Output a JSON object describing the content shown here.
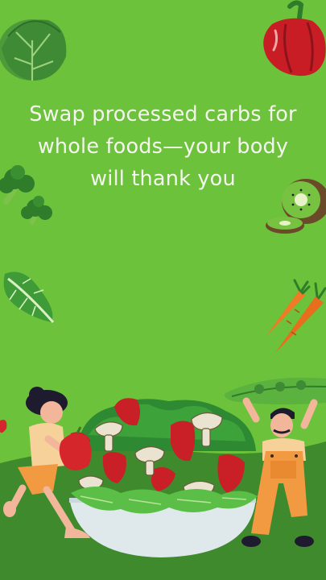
{
  "poster": {
    "headline_lines": [
      "Swap processed carbs for",
      "whole foods—your body",
      "will thank you"
    ]
  },
  "colors": {
    "background": "#6cc23a",
    "ground": "#3f8a2c",
    "text": "#f4f6ee",
    "bowl": "#dfe9ec",
    "pepper": "#c81d25",
    "carrot": "#ef7b26",
    "kiwi": "#78c242",
    "overalls": "#f19a42"
  },
  "illustrations": [
    "cabbage-icon",
    "bell-pepper-icon",
    "broccoli-icon",
    "kiwi-icon",
    "lettuce-icon",
    "carrots-icon",
    "salad-bowl",
    "woman-carrying-tomato",
    "man-holding-pea-pod"
  ]
}
